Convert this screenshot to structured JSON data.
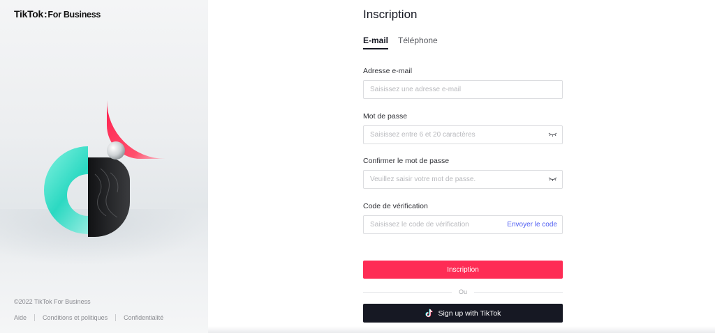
{
  "brand": {
    "name": "TikTok",
    "separator": ":",
    "suffix": "For Business"
  },
  "left_panel": {
    "hero_icon": "tiktok-3d-logo",
    "copyright": "©2022 TikTok For Business",
    "footer_links": [
      "Aide",
      "Conditions et politiques",
      "Confidentialité"
    ]
  },
  "form": {
    "title": "Inscription",
    "tabs": [
      {
        "label": "E-mail",
        "active": true
      },
      {
        "label": "Téléphone",
        "active": false
      }
    ],
    "email": {
      "label": "Adresse e-mail",
      "placeholder": "Saisissez une adresse e-mail",
      "value": ""
    },
    "password": {
      "label": "Mot de passe",
      "placeholder": "Saisissez entre 6 et 20 caractères",
      "value": "",
      "icon": "eye-closed-icon"
    },
    "confirm_password": {
      "label": "Confirmer le mot de passe",
      "placeholder": "Veuillez saisir votre mot de passe.",
      "value": "",
      "icon": "eye-closed-icon"
    },
    "verification": {
      "label": "Code de vérification",
      "placeholder": "Saisissez le code de vérification",
      "value": "",
      "send_label": "Envoyer le code"
    },
    "submit_label": "Inscription",
    "or_label": "Ou",
    "tiktok_button": {
      "label": "Sign up with TikTok",
      "icon": "tiktok-note-icon"
    }
  },
  "colors": {
    "primary": "#fe2c55",
    "dark": "#161823",
    "link": "#4d5cf2",
    "teal": "#25f4ee"
  }
}
